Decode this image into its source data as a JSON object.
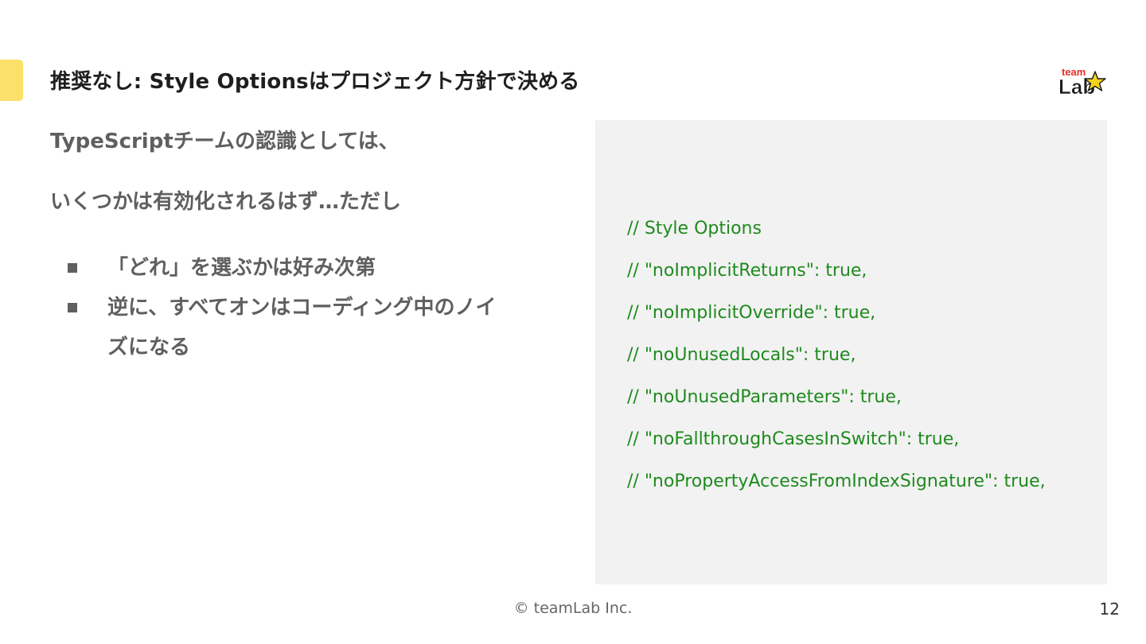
{
  "slide": {
    "title": "推奨なし: Style Optionsはプロジェクト方針で決める",
    "logo": {
      "icon": "teamlab-logo",
      "text_top": "team",
      "text_bottom": "Lab"
    },
    "paragraphs": [
      "TypeScriptチームの認識としては、",
      "いくつかは有効化されるはず…ただし"
    ],
    "bullets": [
      "「どれ」を選ぶかは好み次第",
      "逆に、すべてオンはコーディング中のノイズになる"
    ],
    "code_lines": [
      "// Style Options",
      "// \"noImplicitReturns\": true,",
      "// \"noImplicitOverride\": true,",
      "// \"noUnusedLocals\": true,",
      "// \"noUnusedParameters\": true,",
      "// \"noFallthroughCasesInSwitch\": true,",
      "// \"noPropertyAccessFromIndexSignature\": true,"
    ],
    "footer": "© teamLab Inc.",
    "page_number": "12"
  },
  "colors": {
    "accent": "#fbe06a",
    "code_text": "#1e8a1e",
    "code_background": "#f2f2f2"
  }
}
